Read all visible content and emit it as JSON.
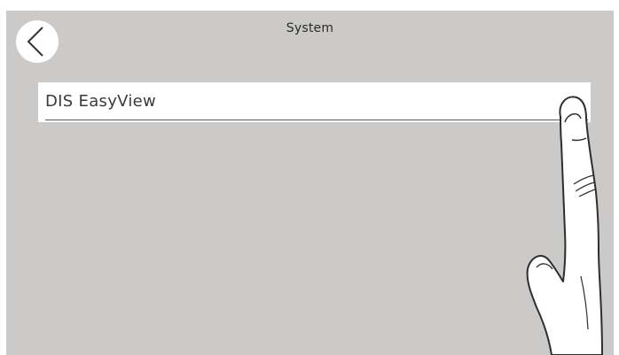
{
  "header": {
    "title": "System",
    "back_icon": "chevron-left-icon"
  },
  "menu": {
    "items": [
      {
        "label": "DIS EasyView"
      }
    ]
  },
  "overlay": {
    "icon": "pointing-hand-icon"
  },
  "colors": {
    "screen_background": "#cbcac8",
    "item_background": "#ffffff",
    "text": "#3a3a3a"
  }
}
